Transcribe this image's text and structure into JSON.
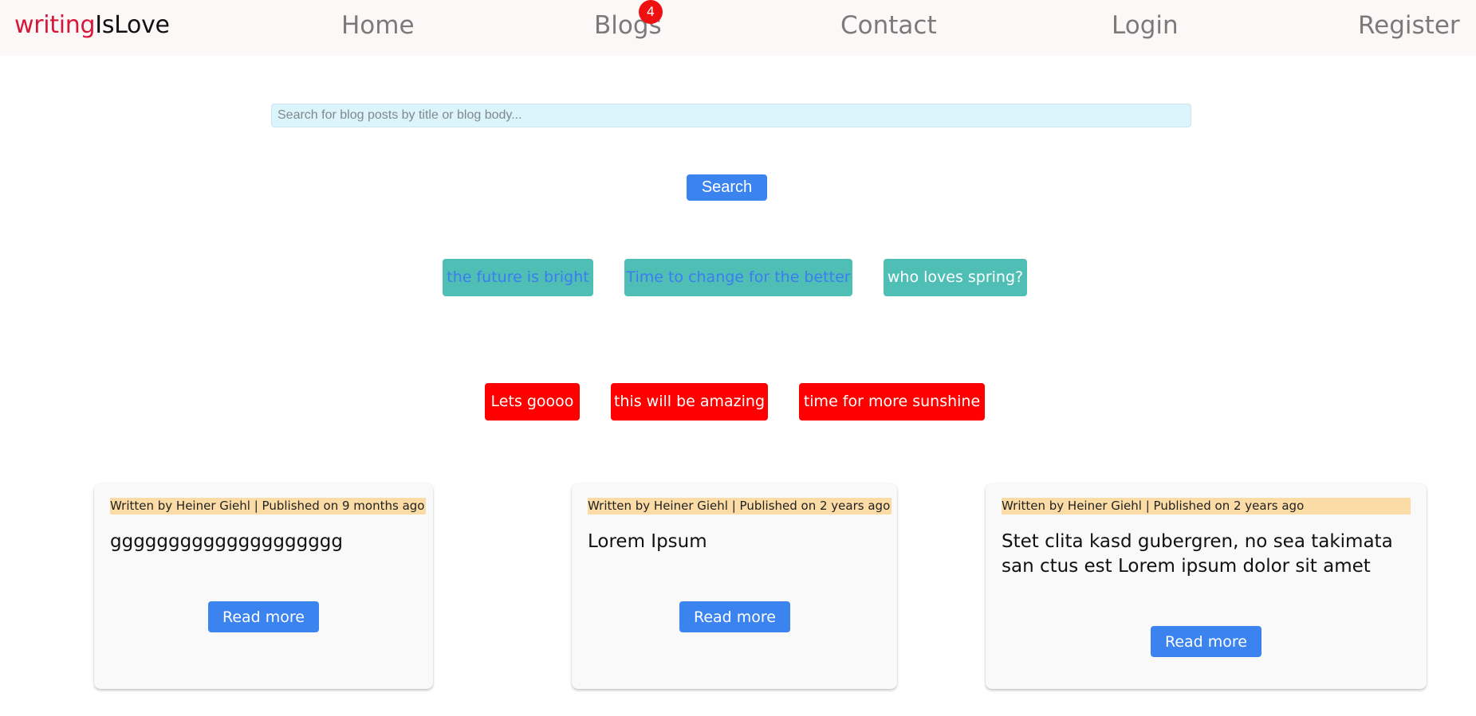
{
  "nav": {
    "brand_part1": "writing",
    "brand_part2": "IsLove",
    "home": "Home",
    "blogs": "Blogs",
    "blogs_badge": "4",
    "contact": "Contact",
    "login": "Login",
    "register": "Register"
  },
  "search": {
    "placeholder": "Search for blog posts by title or blog body...",
    "button_label": "Search"
  },
  "tags_teal": [
    {
      "label": "the future is bright",
      "color": "#3d7cf0"
    },
    {
      "label": "Time to change for the better",
      "color": "#3d7cf0"
    },
    {
      "label": "who loves spring?",
      "color": "#ffffff"
    }
  ],
  "tags_red": [
    {
      "label": "Lets goooo"
    },
    {
      "label": "this will be amazing"
    },
    {
      "label": "time for more sunshine"
    }
  ],
  "posts": [
    {
      "meta": "Written by Heiner Giehl | Published on 9 months ago",
      "title": "gggggggggggggggggggg",
      "read_more": "Read more"
    },
    {
      "meta": "Written by Heiner Giehl | Published on 2 years ago",
      "title": "Lorem Ipsum",
      "read_more": "Read more"
    },
    {
      "meta": "Written by Heiner Giehl | Published on 2 years ago",
      "title": "Stet clita kasd gubergren, no sea takimata san ctus est Lorem ipsum dolor sit amet",
      "read_more": "Read more"
    }
  ],
  "colors": {
    "brand_accent": "#d6173a",
    "primary_button": "#3b84f0",
    "tag_teal": "#4fbfb6",
    "tag_red": "#ff0000",
    "meta_highlight": "#fbdca6",
    "badge": "#ee1111"
  }
}
